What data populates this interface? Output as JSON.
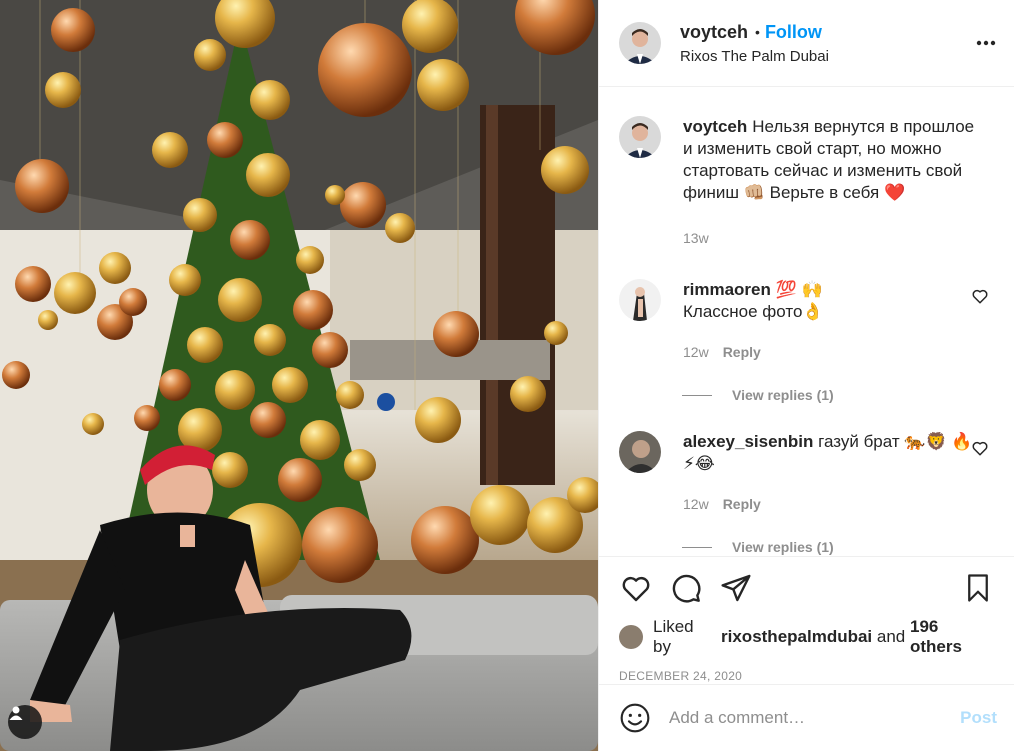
{
  "post": {
    "username": "voytceh",
    "follow_label": "Follow",
    "separator": "•",
    "location": "Rixos The Palm Dubai",
    "more_icon": "more-horizontal-icon"
  },
  "caption": {
    "username": "voytceh",
    "text": "Нельзя вернутся в прошлое и изменить свой старт, но можно стартовать сейчас и изменить свой финиш 👊🏼 Верьте в себя ❤️",
    "age": "13w"
  },
  "comments": [
    {
      "username": "rimmaoren",
      "username_suffix": " 💯 🙌",
      "text": "Классное фото👌",
      "age": "12w",
      "reply_label": "Reply",
      "view_replies_label": "View replies (1)"
    },
    {
      "username": "alexey_sisenbin",
      "text": "газуй брат 🐅🦁 🔥⚡😂",
      "age": "12w",
      "reply_label": "Reply",
      "view_replies_label": "View replies (1)"
    }
  ],
  "actions": {
    "like_icon": "heart-icon",
    "comment_icon": "comment-icon",
    "share_icon": "send-icon",
    "save_icon": "bookmark-icon"
  },
  "likes": {
    "prefix": "Liked by ",
    "user": "rixosthepalmdubai",
    "and": " and ",
    "others": "196 others"
  },
  "date": "DECEMBER 24, 2020",
  "add_comment": {
    "placeholder": "Add a comment…",
    "post_label": "Post"
  },
  "colors": {
    "accent": "#0095f6",
    "post_disabled": "#b2dffc",
    "muted": "#8e8e8e",
    "text": "#262626"
  }
}
